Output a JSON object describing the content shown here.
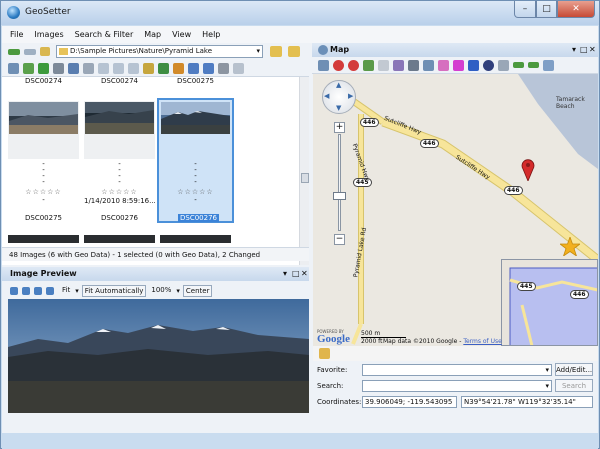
{
  "window": {
    "title": "GeoSetter"
  },
  "menu": [
    "File",
    "Images",
    "Search & Filter",
    "Map",
    "View",
    "Help"
  ],
  "path": {
    "value": "D:\\Sample Pictures\\Nature\\Pyramid Lake"
  },
  "thumbnails": {
    "top_names": [
      "DSC00274",
      "DSC00274",
      "DSC00275"
    ],
    "cells": [
      {
        "name": "DSC00275",
        "stars": "☆☆☆☆☆",
        "dash": "-",
        "date": ""
      },
      {
        "name": "DSC00276",
        "stars": "☆☆☆☆☆",
        "dash": "",
        "date": "1/14/2010 8:59:16..."
      },
      {
        "name": "DSC00276",
        "stars": "☆☆☆☆☆",
        "dash": "-",
        "date": ""
      }
    ]
  },
  "status": {
    "text": "48 Images (6 with Geo Data) - 1 selected (0 with Geo Data), 2 Changed"
  },
  "preview": {
    "title": "Image Preview",
    "fit_label": "Fit",
    "fit_auto_label": "Fit Automatically",
    "zoom": "100%",
    "center_label": "Center"
  },
  "map": {
    "title": "Map",
    "roads": [
      "Sutcliffe Hwy",
      "Sutcliffe Hwy",
      "Pyramid Hwy",
      "Pyramid Lake Rd"
    ],
    "shields": [
      "446",
      "446",
      "446",
      "445",
      "445",
      "446"
    ],
    "place": "Tamarack Beach",
    "scale": "500 m",
    "scale2": "2000 ft",
    "copyright": "Map data ©2010 Google - ",
    "terms": "Terms of Use",
    "logo_small": "POWERED BY",
    "logo": "Google"
  },
  "form": {
    "favorite_label": "Favorite:",
    "search_label": "Search:",
    "coords_label": "Coordinates:",
    "add_edit": "Add/Edit...",
    "search_btn": "Search",
    "coord_decimal": "39.906049; -119.543095",
    "coord_dms": "N39°54'21.78\" W119°32'35.14\""
  },
  "colors": {
    "accent": "#3b83d8",
    "pin": "#d42b2b",
    "star": "#f2b01e",
    "road": "#f7e59a",
    "lake": "#b8c5d8"
  }
}
